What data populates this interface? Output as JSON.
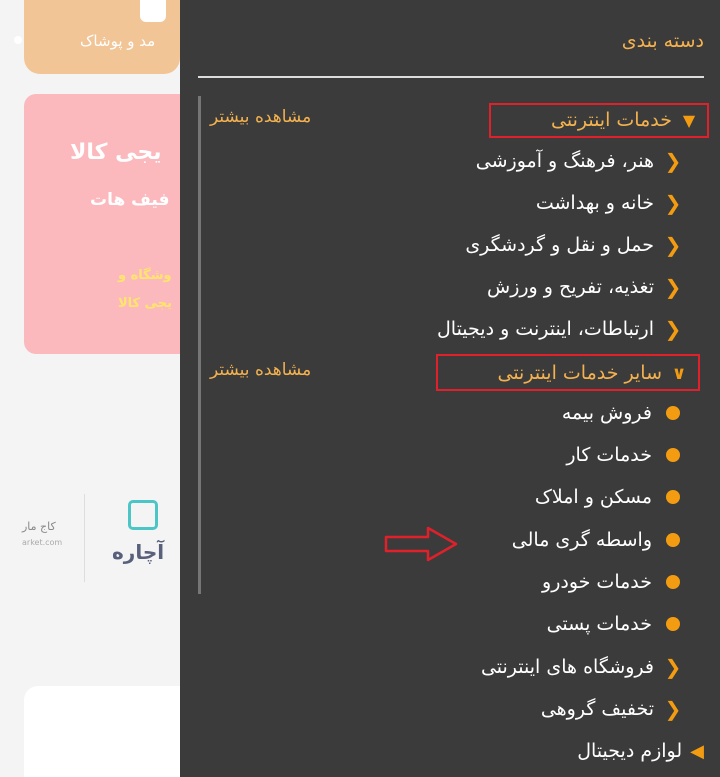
{
  "background": {
    "category_label": "مد و پوشاک",
    "promo_title": "یجی کالا",
    "promo_subtitle": "فیف هات",
    "promo_line1": "وشگاه و",
    "promo_line2": "یجی کالا",
    "logo_a": "کاج مار",
    "logo_a_sub": "arket.com",
    "logo_b": "آچاره"
  },
  "drawer": {
    "title": "دسته بندی",
    "sections": [
      {
        "label": "خدمات اینترنتی",
        "more_label": "مشاهده بیشتر",
        "items": [
          "هنر، فرهنگ و آموزشی",
          "خانه و بهداشت",
          "حمل و نقل و گردشگری",
          "تغذیه، تفریح و ورزش",
          "ارتباطات، اینترنت و دیجیتال"
        ]
      },
      {
        "label": "سایر خدمات اینترنتی",
        "more_label": "مشاهده بیشتر",
        "items": [
          "فروش بیمه",
          "خدمات کار",
          "مسکن و املاک",
          "واسطه گری مالی",
          "خدمات خودرو",
          "خدمات پستی"
        ]
      }
    ],
    "extra_items": [
      "فروشگاه های اینترنتی",
      "تخفیف گروهی"
    ],
    "last_item": "لوازم دیجیتال"
  },
  "colors": {
    "drawer_bg": "#3b3b3b",
    "accent": "#f39c12",
    "accent_text": "#f4b24f",
    "highlight": "#e0202a"
  }
}
